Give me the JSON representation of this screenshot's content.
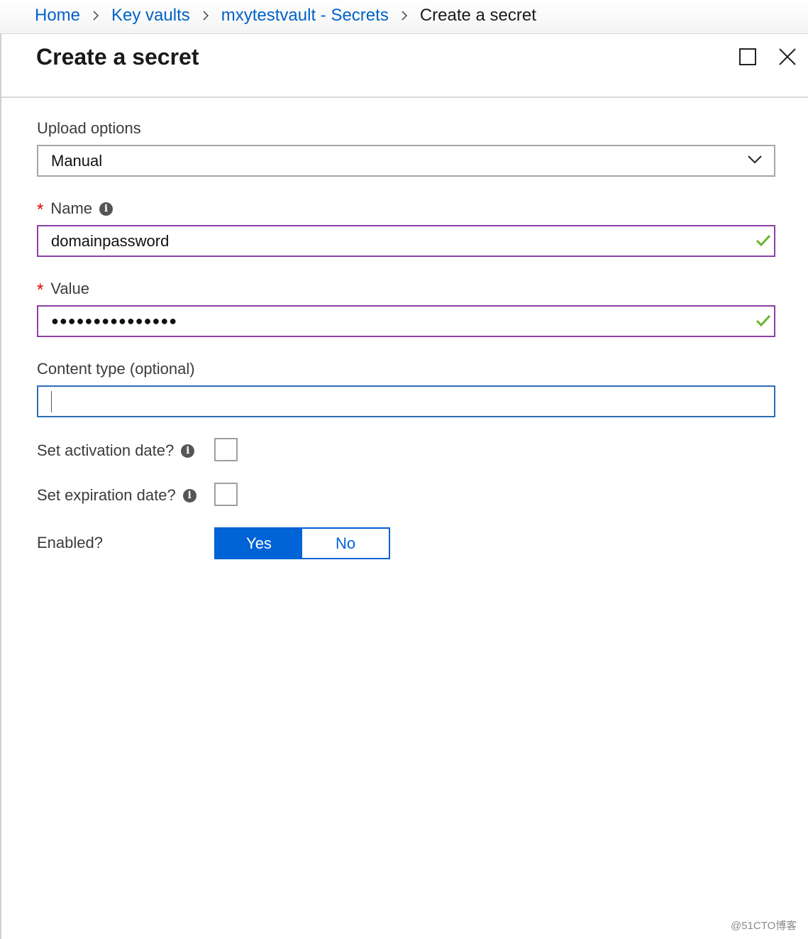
{
  "breadcrumb": {
    "home": "Home",
    "key_vaults": "Key vaults",
    "secrets": "mxytestvault - Secrets",
    "current": "Create a secret"
  },
  "blade": {
    "title": "Create a secret"
  },
  "form": {
    "upload_options": {
      "label": "Upload options",
      "value": "Manual"
    },
    "name": {
      "label": "Name",
      "required": "*",
      "value": "domainpassword"
    },
    "value": {
      "label": "Value",
      "required": "*",
      "masked": "●●●●●●●●●●●●●●●"
    },
    "content_type": {
      "label": "Content type (optional)",
      "value": ""
    },
    "activation": {
      "label": "Set activation date?"
    },
    "expiration": {
      "label": "Set expiration date?"
    },
    "enabled": {
      "label": "Enabled?",
      "yes": "Yes",
      "no": "No",
      "selected": "Yes"
    }
  },
  "colors": {
    "link": "#0062c8",
    "valid_border": "#8c3fa8",
    "check": "#6cb52a",
    "toggle_on": "#0063d6"
  },
  "watermark": "@51CTO博客"
}
